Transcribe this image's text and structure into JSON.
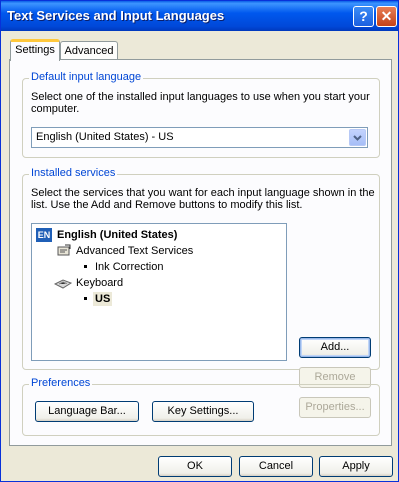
{
  "window": {
    "title": "Text Services and Input Languages"
  },
  "titlebar": {
    "help_label": "?",
    "close_label": "✕"
  },
  "tabs": [
    {
      "label": "Settings"
    },
    {
      "label": "Advanced"
    }
  ],
  "default_input": {
    "legend": "Default input language",
    "description": "Select one of the installed input languages to use when you start your computer.",
    "selected": "English (United States) - US"
  },
  "installed": {
    "legend": "Installed services",
    "description": "Select the services that you want for each input language shown in the list. Use the Add and Remove buttons to modify this list.",
    "language_badge": "EN",
    "tree": {
      "language": "English (United States)",
      "text_services": "Advanced Text Services",
      "ink": "Ink Correction",
      "keyboard": "Keyboard",
      "layout": "US"
    },
    "buttons": {
      "add": "Add...",
      "remove": "Remove",
      "properties": "Properties..."
    }
  },
  "preferences": {
    "legend": "Preferences",
    "language_bar": "Language Bar...",
    "key_settings": "Key Settings..."
  },
  "footer": {
    "ok": "OK",
    "cancel": "Cancel",
    "apply": "Apply"
  },
  "colors": {
    "title_blue": "#0054E3",
    "legend_blue": "#0046D5",
    "tab_highlight": "#FFC83C"
  }
}
